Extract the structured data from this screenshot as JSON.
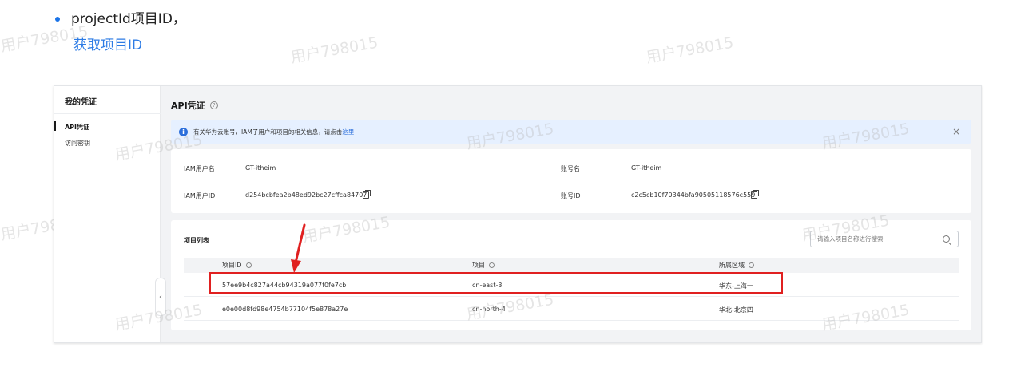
{
  "doc": {
    "bullet_text": "projectId项目ID，",
    "link_text": "获取项目ID"
  },
  "watermark": "用户798015",
  "sidebar": {
    "title": "我的凭证",
    "items": [
      {
        "label": "API凭证",
        "active": true
      },
      {
        "label": "访问密钥",
        "active": false
      }
    ],
    "collapse_glyph": "‹"
  },
  "main": {
    "title": "API凭证",
    "help_glyph": "?",
    "notice": {
      "icon": "info-icon",
      "text": "有关华为云账号，IAM子用户和项目的相关信息，请点击",
      "link": "这里",
      "close_glyph": "×"
    },
    "account_info": {
      "iam_user_name_label": "IAM用户名",
      "iam_user_name": "GT-itheim",
      "iam_user_id_label": "IAM用户ID",
      "iam_user_id": "d254bcbfea2b48ed92bc27cffca84707",
      "account_name_label": "账号名",
      "account_name": "GT-itheim",
      "account_id_label": "账号ID",
      "account_id": "c2c5cb10f70344bfa90505118576c559"
    },
    "project_list": {
      "title": "项目列表",
      "search_placeholder": "请输入项目名称进行搜索",
      "columns": [
        "项目ID",
        "项目",
        "所属区域"
      ],
      "rows": [
        {
          "id": "57ee9b4c827a44cb94319a077f0fe7cb",
          "project": "cn-east-3",
          "region": "华东-上海一"
        },
        {
          "id": "e0e00d8fd98e4754b77104f5e878a27e",
          "project": "cn-north-4",
          "region": "华北-北京四"
        }
      ]
    }
  },
  "colors": {
    "highlight": "#e02020",
    "link": "#2c7be5",
    "notice_bg": "#e6f0ff"
  }
}
